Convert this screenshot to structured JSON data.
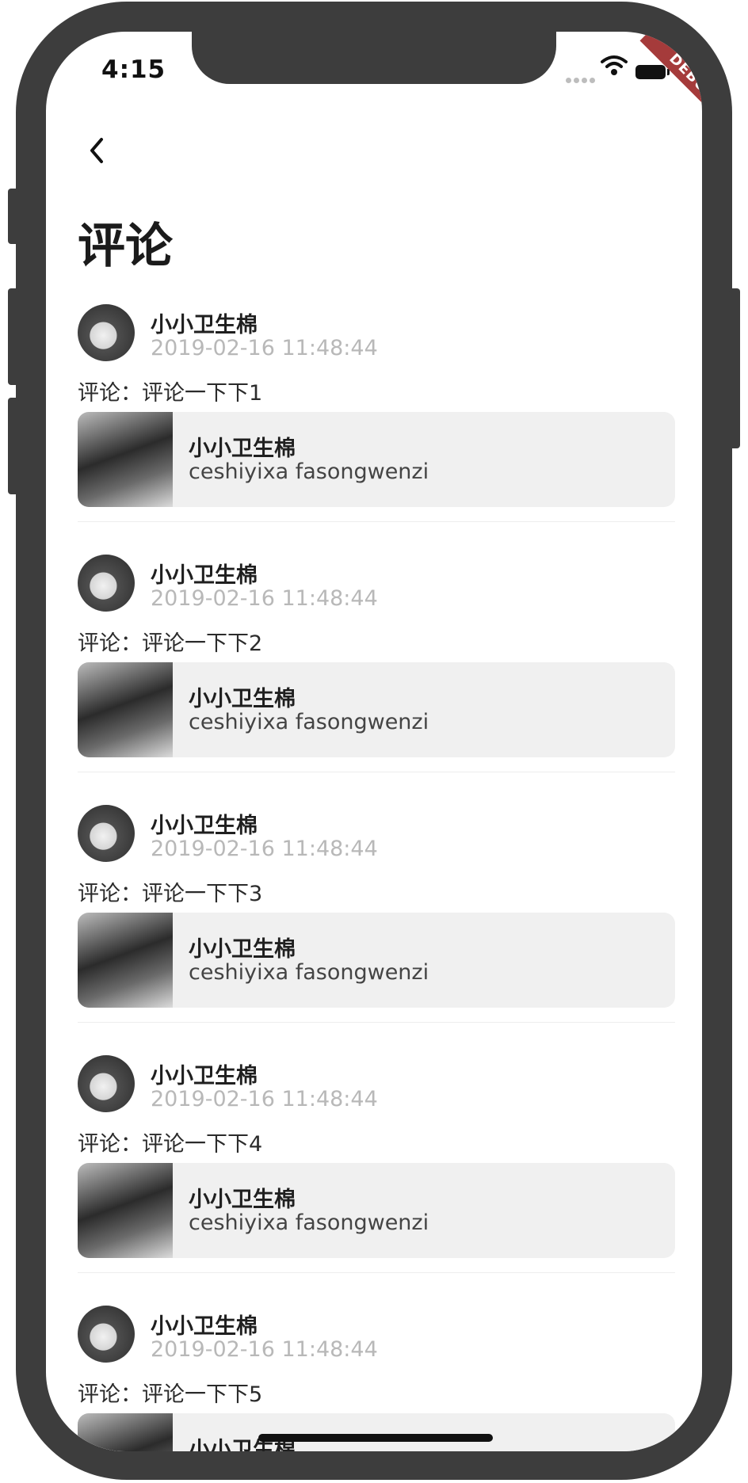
{
  "status_bar": {
    "time": "4:15",
    "debug_banner": "DEBUG"
  },
  "header": {
    "back_icon": "chevron-left-icon",
    "title": "评论"
  },
  "comments": [
    {
      "user": "小小卫生棉",
      "time": "2019-02-16 11:48:44",
      "comment": "评论：评论一下下1",
      "quote_user": "小小卫生棉",
      "quote_text": "ceshiyixa fasongwenzi"
    },
    {
      "user": "小小卫生棉",
      "time": "2019-02-16 11:48:44",
      "comment": "评论：评论一下下2",
      "quote_user": "小小卫生棉",
      "quote_text": "ceshiyixa fasongwenzi"
    },
    {
      "user": "小小卫生棉",
      "time": "2019-02-16 11:48:44",
      "comment": "评论：评论一下下3",
      "quote_user": "小小卫生棉",
      "quote_text": "ceshiyixa fasongwenzi"
    },
    {
      "user": "小小卫生棉",
      "time": "2019-02-16 11:48:44",
      "comment": "评论：评论一下下4",
      "quote_user": "小小卫生棉",
      "quote_text": "ceshiyixa fasongwenzi"
    },
    {
      "user": "小小卫生棉",
      "time": "2019-02-16 11:48:44",
      "comment": "评论：评论一下下5",
      "quote_user": "小小卫生棉",
      "quote_text": ""
    }
  ]
}
